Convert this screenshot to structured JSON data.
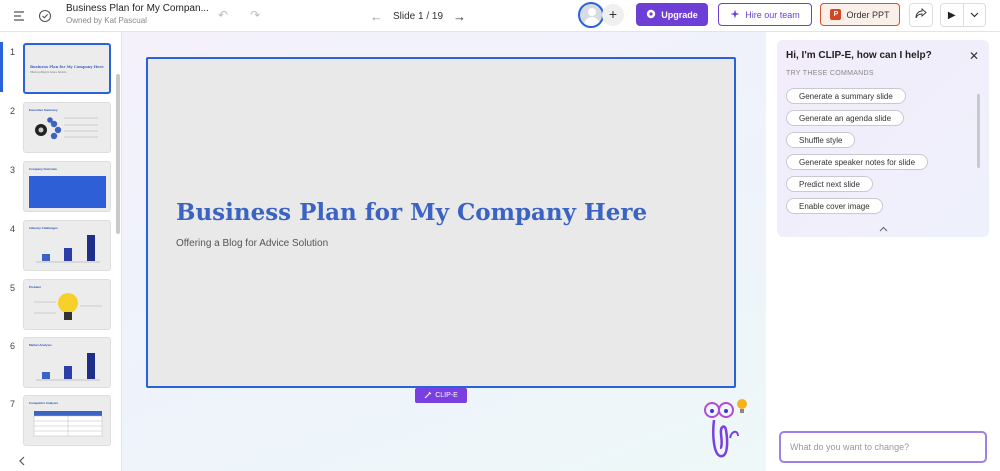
{
  "header": {
    "doc_title": "Business Plan for My Compan...",
    "owner": "Owned by Kat Pascual",
    "slide_indicator": "Slide 1 / 19",
    "upgrade_label": "Upgrade",
    "hire_label": "Hire our team",
    "order_label": "Order PPT",
    "add_user_symbol": "+"
  },
  "thumbnails": [
    {
      "num": "1",
      "title": "Business Plan for My Company Here",
      "subtitle": "Offering a Blog for Advice Solution"
    },
    {
      "num": "2",
      "title": "Executive Summary"
    },
    {
      "num": "3",
      "title": "Company Overview"
    },
    {
      "num": "4",
      "title": "Industry Challenges"
    },
    {
      "num": "5",
      "title": "Problem"
    },
    {
      "num": "6",
      "title": "Market Analysis"
    },
    {
      "num": "7",
      "title": "Competitor Analysis"
    }
  ],
  "slide": {
    "title": "Business Plan for My Company Here",
    "subtitle": "Offering a Blog for Advice Solution"
  },
  "clipe_tag": "CLIP-E",
  "assistant": {
    "greeting": "Hi, I'm CLIP-E, how can I help?",
    "hint": "TRY THESE COMMANDS",
    "commands": [
      "Generate a summary slide",
      "Generate an agenda slide",
      "Shuffle style",
      "Generate speaker notes for slide",
      "Predict next slide",
      "Enable cover image"
    ],
    "input_placeholder": "What do you want to change?"
  },
  "colors": {
    "accent_blue": "#2a62d9",
    "brand_purple": "#6d3fd6",
    "order_orange": "#d6512a",
    "slide_title": "#3b63c4"
  }
}
